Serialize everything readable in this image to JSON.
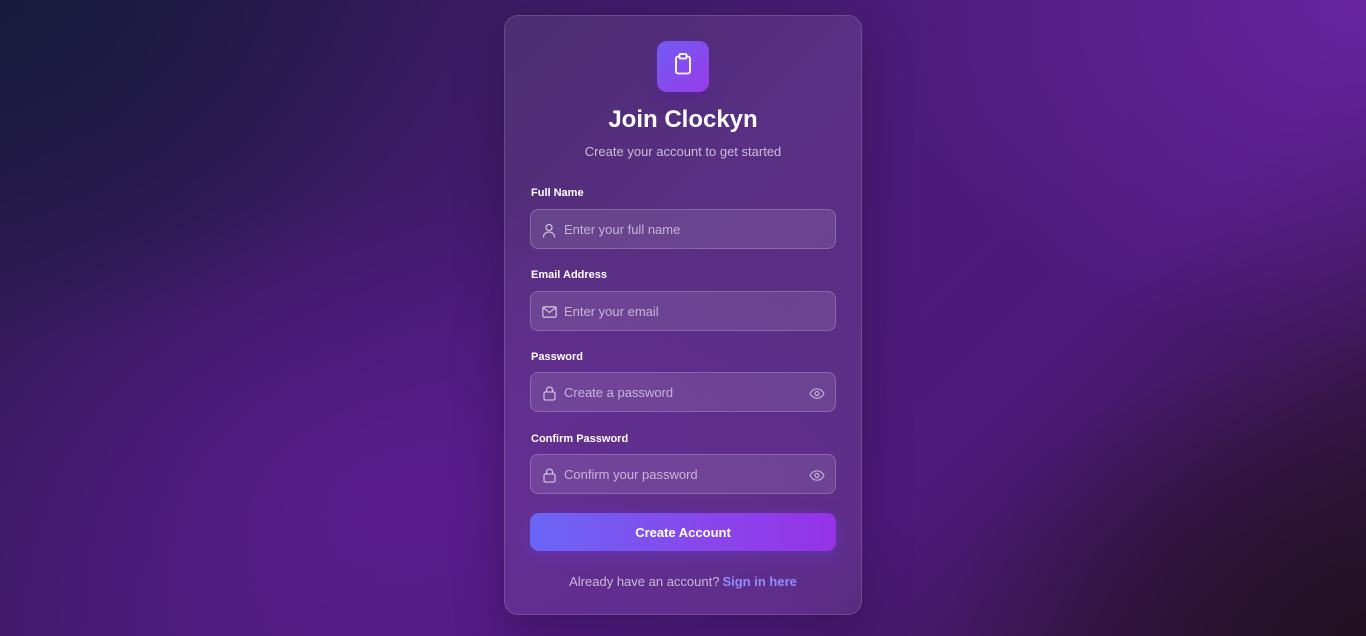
{
  "app": {
    "title": "Join Clockyn",
    "subtitle": "Create your account to get started",
    "logo_icon": "clipboard-icon"
  },
  "form": {
    "full_name": {
      "label": "Full Name",
      "placeholder": "Enter your full name",
      "value": "",
      "icon": "user-icon"
    },
    "email": {
      "label": "Email Address",
      "placeholder": "Enter your email",
      "value": "",
      "icon": "mail-icon"
    },
    "password": {
      "label": "Password",
      "placeholder": "Create a password",
      "value": "",
      "icon": "lock-icon",
      "toggle_icon": "eye-icon"
    },
    "confirm_password": {
      "label": "Confirm Password",
      "placeholder": "Confirm your password",
      "value": "",
      "icon": "lock-icon",
      "toggle_icon": "eye-icon"
    },
    "submit_label": "Create Account"
  },
  "footer": {
    "prompt": "Already have an account?",
    "link_label": "Sign in here"
  },
  "colors": {
    "accent_start": "#6a66f5",
    "accent_end": "#9433e6",
    "link": "#8f8cff"
  }
}
